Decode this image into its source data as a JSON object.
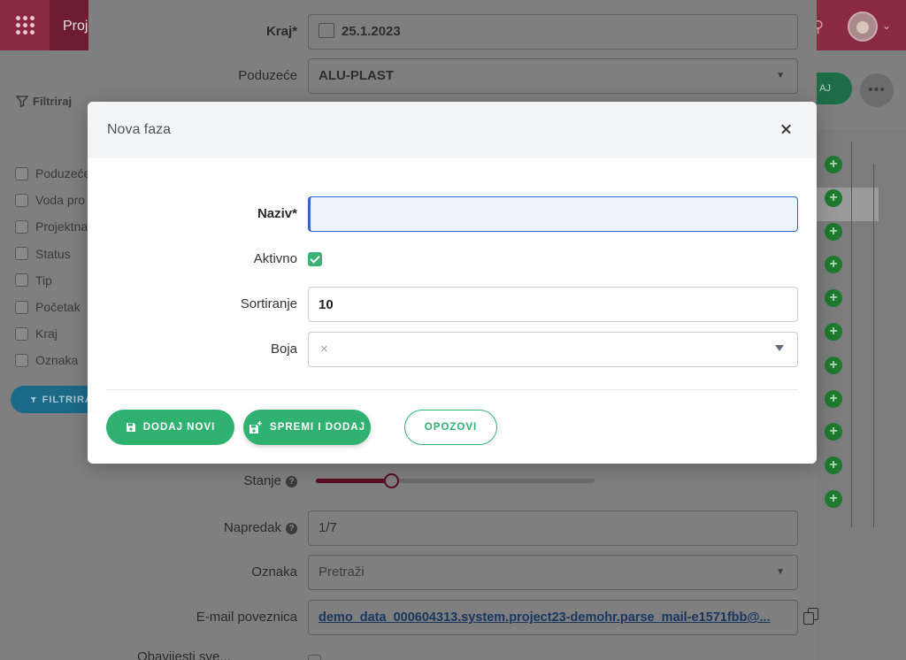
{
  "background": {
    "app_tab_label": "Proj",
    "filters": {
      "title": "Filtriraj",
      "items": [
        "Poduzeće",
        "Voda pro",
        "Projektna",
        "Status",
        "Tip",
        "Početak",
        "Kraj",
        "Oznaka"
      ],
      "button_label": "FILTRIRAJ"
    },
    "right_panel": {
      "save_button_label": "AJ",
      "more_button_label": "•••",
      "add_buttons_count": 11
    },
    "form": {
      "kraj": {
        "label": "Kraj*",
        "value": "25.1.2023"
      },
      "poduzece": {
        "label": "Poduzeće",
        "value": "ALU-PLAST"
      },
      "stanje": {
        "label": "Stanje",
        "progress_percent": 27
      },
      "napredak": {
        "label": "Napredak",
        "value": "1/7"
      },
      "oznaka": {
        "label": "Oznaka",
        "value": "Pretraži"
      },
      "email": {
        "label": "E-mail poveznica",
        "value": "demo_data_000604313.system.project23-demohr.parse_mail-e1571fbb@..."
      },
      "partial_label": "Obavijesti sve..."
    }
  },
  "dialog": {
    "title": "Nova faza",
    "fields": {
      "naziv": {
        "label": "Naziv*",
        "value": ""
      },
      "aktivno": {
        "label": "Aktivno",
        "checked": true
      },
      "sortiranje": {
        "label": "Sortiranje",
        "value": "10"
      },
      "boja": {
        "label": "Boja",
        "clear_symbol": "×"
      }
    },
    "buttons": {
      "add_new": "DODAJ NOVI",
      "save_and_add": "SPREMI I DODAJ",
      "cancel": "OPOZOVI"
    }
  },
  "colors": {
    "primary_green": "#2fb170",
    "focus_blue": "#2f66c9",
    "brand_crimson": "#8a2a40"
  }
}
